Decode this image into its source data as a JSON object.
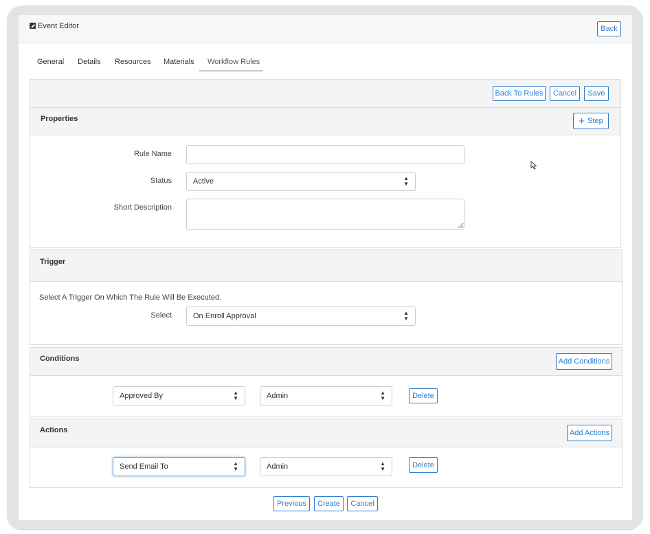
{
  "header": {
    "title": "Event Editor",
    "icon": "edit-icon",
    "back_label": "Back"
  },
  "tabs": [
    {
      "label": "General"
    },
    {
      "label": "Details"
    },
    {
      "label": "Resources"
    },
    {
      "label": "Materials"
    },
    {
      "label": "Workflow Rules",
      "active": true
    }
  ],
  "toolbar": {
    "back_to_rules": "Back To Rules",
    "cancel": "Cancel",
    "save": "Save"
  },
  "properties": {
    "title": "Properties",
    "step_label": "Step",
    "rule_name_label": "Rule Name",
    "rule_name_value": "",
    "status_label": "Status",
    "status_value": "Active",
    "short_description_label": "Short Description",
    "short_description_value": ""
  },
  "trigger": {
    "title": "Trigger",
    "hint": "Select A Trigger On Which The Rule Will Be Executed.",
    "select_label": "Select",
    "select_value": "On Enroll Approval"
  },
  "conditions": {
    "title": "Conditions",
    "add_label": "Add Conditions",
    "field_value": "Approved By",
    "operand_value": "Admin",
    "delete_label": "Delete"
  },
  "actions": {
    "title": "Actions",
    "add_label": "Add Actions",
    "field_value": "Send Email To",
    "operand_value": "Admin",
    "delete_label": "Delete"
  },
  "footer": {
    "previous": "Previous",
    "create": "Create",
    "cancel": "Cancel"
  },
  "colors": {
    "accent": "#2f7dd1",
    "section_header": "#f4f4f4",
    "frame": "#e3e3e3"
  }
}
